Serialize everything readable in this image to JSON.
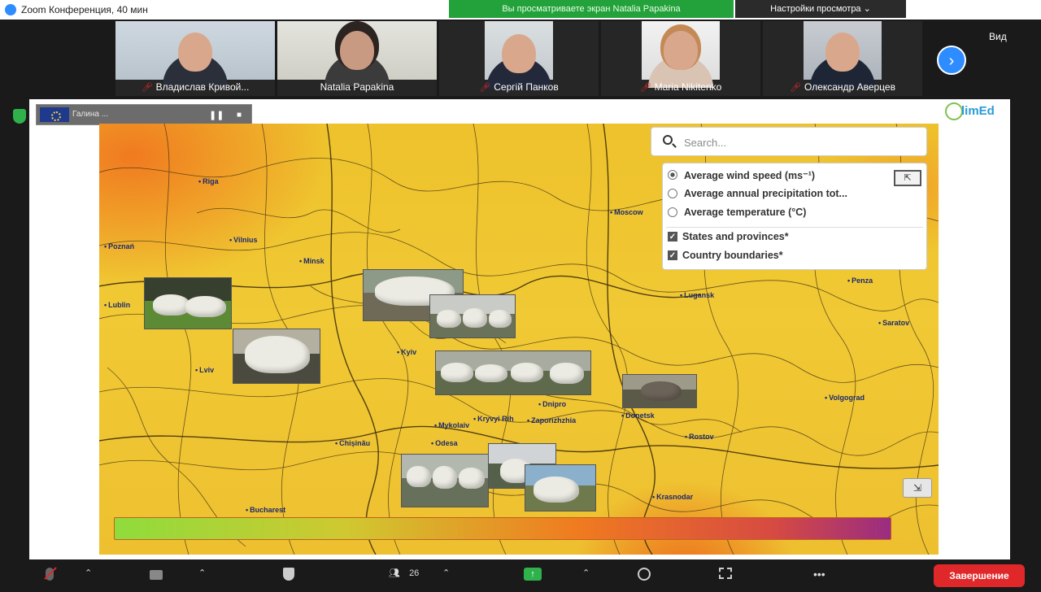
{
  "window": {
    "title": "Zoom Конференция, 40 мин",
    "share_banner": "Вы просматриваете экран Natalia Papakina",
    "view_options": "Настройки просмотра ⌄"
  },
  "participants": [
    {
      "name": "Владислав Кривой...",
      "muted": true
    },
    {
      "name": "Natalia Papakina",
      "muted": false
    },
    {
      "name": "Сергій Панков",
      "muted": true
    },
    {
      "name": "Maria Nikitenko",
      "muted": true
    },
    {
      "name": "Олександр Аверцев",
      "muted": true
    }
  ],
  "strip": {
    "next_page_icon": "›",
    "view_label": "Вид"
  },
  "share_toolbar": {
    "title": "Галина ..."
  },
  "brand": {
    "logo_text": "limEd"
  },
  "search": {
    "placeholder": "Search..."
  },
  "layers": {
    "base": [
      {
        "label": "Average wind speed (ms⁻¹)",
        "selected": true
      },
      {
        "label": "Average annual precipitation tot...",
        "selected": false
      },
      {
        "label": "Average temperature (°C)",
        "selected": false
      }
    ],
    "overlays": [
      {
        "label": "States and provinces*",
        "checked": true
      },
      {
        "label": "Country boundaries*",
        "checked": true
      }
    ],
    "collapse_icon": "⇱",
    "expand_icon": "⇲"
  },
  "map_labels": [
    "Moscow",
    "Minsk",
    "Riga",
    "Vilnius",
    "Lublin",
    "Kyiv",
    "Lviv",
    "Poznań",
    "Lugansk",
    "Penza",
    "Saratov",
    "Volgograd",
    "Dnipro",
    "Zaporizhzhia",
    "Kryvyi Rih",
    "Odesa",
    "Chișinău",
    "Mykolaiv",
    "Rostov",
    "Krasnodar",
    "Bucharest",
    "Donetsk"
  ],
  "toolbar": {
    "participants_count": "26",
    "end_label": "Завершение"
  }
}
